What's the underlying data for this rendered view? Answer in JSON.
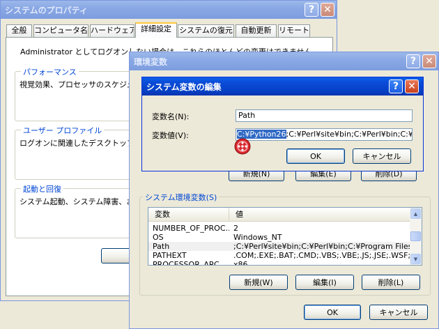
{
  "system_properties": {
    "title": "システムのプロパティ",
    "help": "?",
    "close": "✕",
    "tabs": [
      "全般",
      "コンピュータ名",
      "ハードウェア",
      "詳細設定",
      "システムの復元",
      "自動更新",
      "リモート"
    ],
    "intro_text": "Administrator としてログオンしない場合は、これらのほとんどの変更はできません。",
    "performance": {
      "label": "パフォーマンス",
      "text": "視覚効果、プロセッサのスケジュ"
    },
    "user_profile": {
      "label": "ユーザー プロファイル",
      "text": "ログオンに関連したデスクトップ設"
    },
    "startup": {
      "label": "起動と回復",
      "text": "システム起動、システム障害、お"
    }
  },
  "env_vars": {
    "title": "環境変数",
    "help": "?",
    "close": "✕",
    "user_buttons": [
      "新規(N)",
      "編集(E)",
      "削除(D)"
    ],
    "system_group_label": "システム環境変数(S)",
    "columns": [
      "変数",
      "値"
    ],
    "rows": [
      {
        "name": "NUMBER_OF_PROC...",
        "value": "2"
      },
      {
        "name": "OS",
        "value": "Windows_NT"
      },
      {
        "name": "Path",
        "value": ";C:¥Perl¥site¥bin;C:¥Perl¥bin;C:¥Program Files..."
      },
      {
        "name": "PATHEXT",
        "value": ".COM;.EXE;.BAT;.CMD;.VBS;.VBE;.JS;.JSE;.WSF;..."
      },
      {
        "name": "PROCESSOR_ARC...",
        "value": "x86"
      }
    ],
    "system_buttons": {
      "new": "新規(W)",
      "edit": "編集(I)",
      "delete": "削除(L)"
    },
    "ok": "OK",
    "cancel": "キャンセル"
  },
  "edit_dialog": {
    "title": "システム変数の編集",
    "help": "?",
    "close": "✕",
    "name_label": "変数名(N):",
    "name_value": "Path",
    "value_label": "変数値(V):",
    "value_selected": "C:¥Python26",
    "value_rest": ";C:¥Perl¥site¥bin;C:¥Perl¥bin;C:¥Progr",
    "ok": "OK",
    "cancel": "キャンセル"
  },
  "colors": {
    "title_active": "#0a4bd6",
    "title_inactive": "#8aa8e4",
    "group_label": "#0046d5",
    "selection": "#316ac5",
    "cursor_red": "#d8282e"
  },
  "icons": {
    "cursor": "red-cursor-icon"
  }
}
